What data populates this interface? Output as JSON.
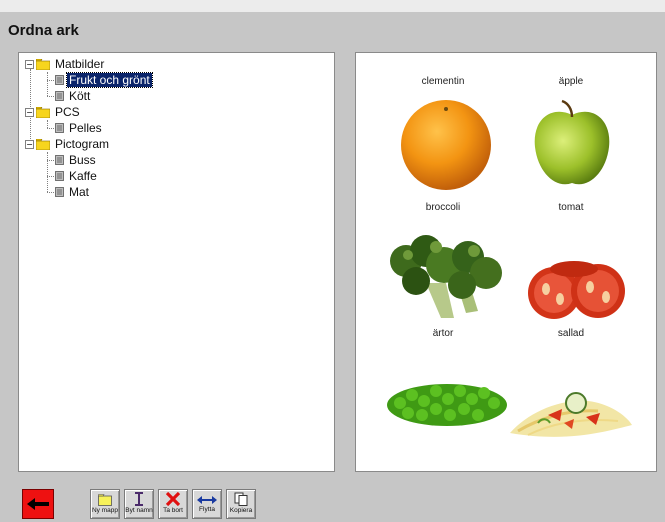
{
  "window": {
    "title": "Ordna ark"
  },
  "tree": {
    "folders": [
      {
        "label": "Matbilder",
        "expanded": true,
        "items": [
          {
            "label": "Frukt och grönt",
            "selected": true
          },
          {
            "label": "Kött",
            "selected": false
          }
        ]
      },
      {
        "label": "PCS",
        "expanded": true,
        "items": [
          {
            "label": "Pelles",
            "selected": false
          }
        ]
      },
      {
        "label": "Pictogram",
        "expanded": true,
        "items": [
          {
            "label": "Buss",
            "selected": false
          },
          {
            "label": "Kaffe",
            "selected": false
          },
          {
            "label": "Mat",
            "selected": false
          }
        ]
      }
    ]
  },
  "preview": {
    "cards": [
      {
        "label": "clementin",
        "icon": "clementine-image"
      },
      {
        "label": "äpple",
        "icon": "apple-image"
      },
      {
        "label": "broccoli",
        "icon": "broccoli-image"
      },
      {
        "label": "tomat",
        "icon": "tomato-image"
      },
      {
        "label": "ärtor",
        "icon": "peas-image"
      },
      {
        "label": "sallad",
        "icon": "salad-image"
      }
    ]
  },
  "toolbar": {
    "back_icon": "back-arrow-icon",
    "new_folder_label": "Ny mapp",
    "rename_label": "Byt namn",
    "delete_label": "Ta bort",
    "move_label": "Flytta",
    "copy_label": "Kopiera"
  },
  "colors": {
    "background": "#c6c6c6",
    "selection": "#0a246a",
    "back_button": "#ee1111"
  }
}
